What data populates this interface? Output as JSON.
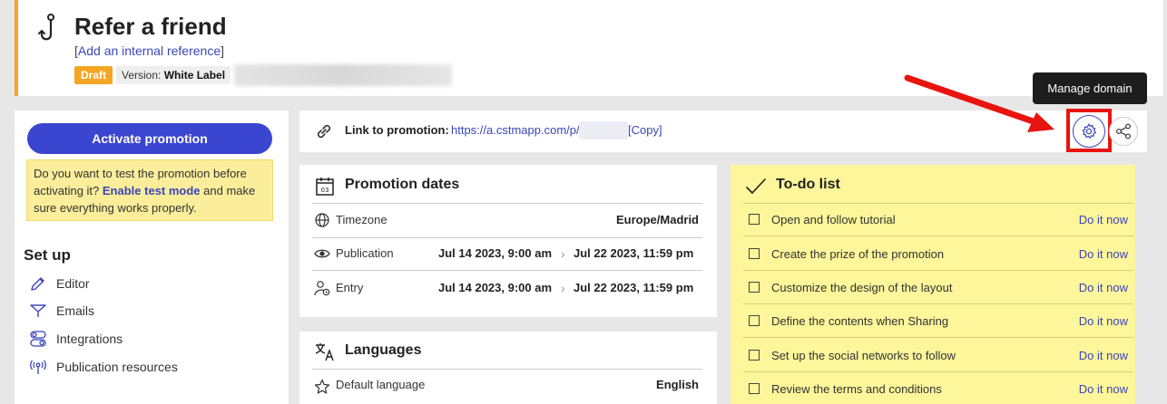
{
  "header": {
    "title": "Refer a friend",
    "reference_prefix": "[",
    "reference_link": "Add an internal reference",
    "reference_suffix": "]",
    "status_badge": "Draft",
    "version_label": "Version:",
    "version_value": "White Label"
  },
  "left_panel": {
    "activate_button": "Activate promotion",
    "test_notice_before": "Do you want to test the promotion before activating it?",
    "test_notice_link": "Enable test mode",
    "test_notice_after": "and make sure everything works properly.",
    "setup_title": "Set up",
    "setup_items": [
      {
        "label": "Editor",
        "icon": "pencil-icon"
      },
      {
        "label": "Emails",
        "icon": "send-icon"
      },
      {
        "label": "Integrations",
        "icon": "toggles-icon"
      },
      {
        "label": "Publication resources",
        "icon": "antenna-icon"
      }
    ]
  },
  "link_bar": {
    "label": "Link to promotion:",
    "url": "https://a.cstmapp.com/p/",
    "copy": "[Copy]",
    "tooltip": "Manage domain"
  },
  "dates": {
    "title": "Promotion dates",
    "timezone_label": "Timezone",
    "timezone_value": "Europe/Madrid",
    "publication_label": "Publication",
    "publication_start": "Jul 14 2023, 9:00 am",
    "publication_end": "Jul 22 2023, 11:59 pm",
    "entry_label": "Entry",
    "entry_start": "Jul 14 2023, 9:00 am",
    "entry_end": "Jul 22 2023, 11:59 pm"
  },
  "languages": {
    "title": "Languages",
    "default_label": "Default language",
    "default_value": "English"
  },
  "todo": {
    "title": "To-do list",
    "items": [
      {
        "text": "Open and follow tutorial",
        "action": "Do it now"
      },
      {
        "text": "Create the prize of the promotion",
        "action": "Do it now"
      },
      {
        "text": "Customize the design of the layout",
        "action": "Do it now"
      },
      {
        "text": "Define the contents when Sharing",
        "action": "Do it now"
      },
      {
        "text": "Set up the social networks to follow",
        "action": "Do it now"
      },
      {
        "text": "Review the terms and conditions",
        "action": "Do it now"
      }
    ]
  },
  "colors": {
    "accent": "#3b46d0",
    "draft": "#f5a623",
    "todo_bg": "#fdf69a",
    "highlight": "#e8140f"
  }
}
